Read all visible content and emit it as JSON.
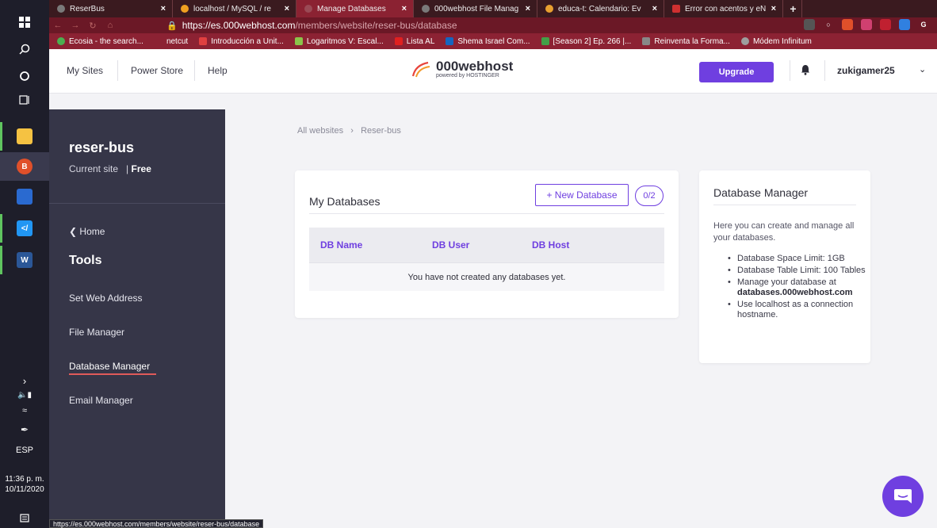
{
  "taskbar": {
    "language": "ESP",
    "time": "11:36 p. m.",
    "date": "10/11/2020"
  },
  "browser": {
    "tabs": [
      {
        "title": "ReserBus",
        "color": "#7a7a7a"
      },
      {
        "title": "localhost / MySQL / re",
        "color": "#f0a020"
      },
      {
        "title": "Manage Databases",
        "color": "#7a7a7a"
      },
      {
        "title": "000webhost File Manag",
        "color": "#7a7a7a"
      },
      {
        "title": "educa-t: Calendario: Ev",
        "color": "#e8a030"
      },
      {
        "title": "Error con acentos y eÑ",
        "color": "#d03030"
      }
    ],
    "url_host": "https://es.000webhost.com",
    "url_path": "/members/website/reser-bus/database",
    "bookmarks": [
      {
        "label": "Ecosia - the search...",
        "color": "#4caf50"
      },
      {
        "label": "netcut",
        "color": "#8c2233"
      },
      {
        "label": "Introducción a Unit...",
        "color": "#e04040"
      },
      {
        "label": "Logaritmos V: Escal...",
        "color": "#8bc34a"
      },
      {
        "label": "Lista AL",
        "color": "#e02020"
      },
      {
        "label": "Shema Israel Com...",
        "color": "#1565c0"
      },
      {
        "label": "[Season 2] Ep. 266 |...",
        "color": "#43a047"
      },
      {
        "label": "Reinventa la Forma...",
        "color": "#888888"
      },
      {
        "label": "Módem Infinitum",
        "color": "#9e9e9e"
      }
    ],
    "status_url": "https://es.000webhost.com/members/website/reser-bus/database"
  },
  "header": {
    "my_sites": "My Sites",
    "power_store": "Power Store",
    "help": "Help",
    "logo_text": "000webhost",
    "logo_sub": "powered by HOSTINGER",
    "upgrade": "Upgrade",
    "username": "zukigamer25"
  },
  "sidebar": {
    "site_name": "reser-bus",
    "site_label": "Current site",
    "plan": "Free",
    "home": "Home",
    "tools_heading": "Tools",
    "items": [
      {
        "label": "Set Web Address"
      },
      {
        "label": "File Manager"
      },
      {
        "label": "Database Manager"
      },
      {
        "label": "Email Manager"
      }
    ]
  },
  "breadcrumb": {
    "root": "All websites",
    "current": "Reser-bus"
  },
  "databases": {
    "title": "My Databases",
    "new_button": "+ New Database",
    "count": "0/2",
    "columns": [
      "DB Name",
      "DB User",
      "DB Host"
    ],
    "empty_message": "You have not created any databases yet."
  },
  "manager": {
    "title": "Database Manager",
    "description": "Here you can create and manage all your databases.",
    "bullets": [
      {
        "text": "Database Space Limit: 1GB"
      },
      {
        "text": "Database Table Limit: 100 Tables"
      },
      {
        "text": "Manage your database at ",
        "bold": "databases.000webhost.com"
      },
      {
        "text": "Use localhost as a connection hostname."
      }
    ]
  },
  "colors": {
    "accent": "#6f3fe0",
    "sidebar_bg": "#363648",
    "active_underline": "#e05a5a"
  }
}
